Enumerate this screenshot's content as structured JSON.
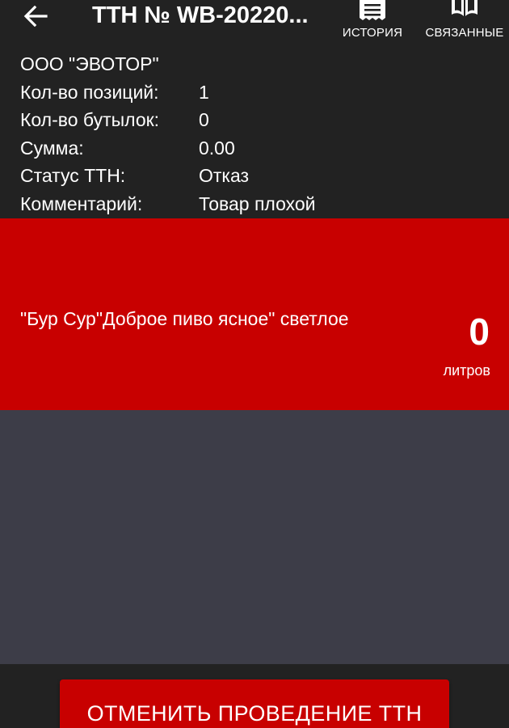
{
  "header": {
    "title": "ТТН № WB-20220...",
    "actions": [
      {
        "icon": "receipt-icon",
        "label": "ИСТОРИЯ"
      },
      {
        "icon": "book-icon",
        "label": "СВЯЗАННЫЕ"
      }
    ]
  },
  "info": {
    "organization": "ООО \"ЭВОТОР\"",
    "rows": [
      {
        "label": "Кол-во позиций:",
        "value": "1"
      },
      {
        "label": "Кол-во бутылок:",
        "value": "0"
      },
      {
        "label": "Сумма:",
        "value": "0.00"
      },
      {
        "label": "Статус ТТН:",
        "value": "Отказ"
      },
      {
        "label": "Комментарий:",
        "value": "Товар плохой"
      }
    ]
  },
  "items": [
    {
      "name": "\"Бур Сур\"Доброе пиво ясное\" светлое",
      "quantity": "0",
      "unit": "литров"
    }
  ],
  "footer": {
    "cancel_label": "ОТМЕНИТЬ ПРОВЕДЕНИЕ ТТН"
  },
  "colors": {
    "background": "#222222",
    "accent_red": "#c80000",
    "list_background": "#3d3d48",
    "text": "#ffffff"
  }
}
